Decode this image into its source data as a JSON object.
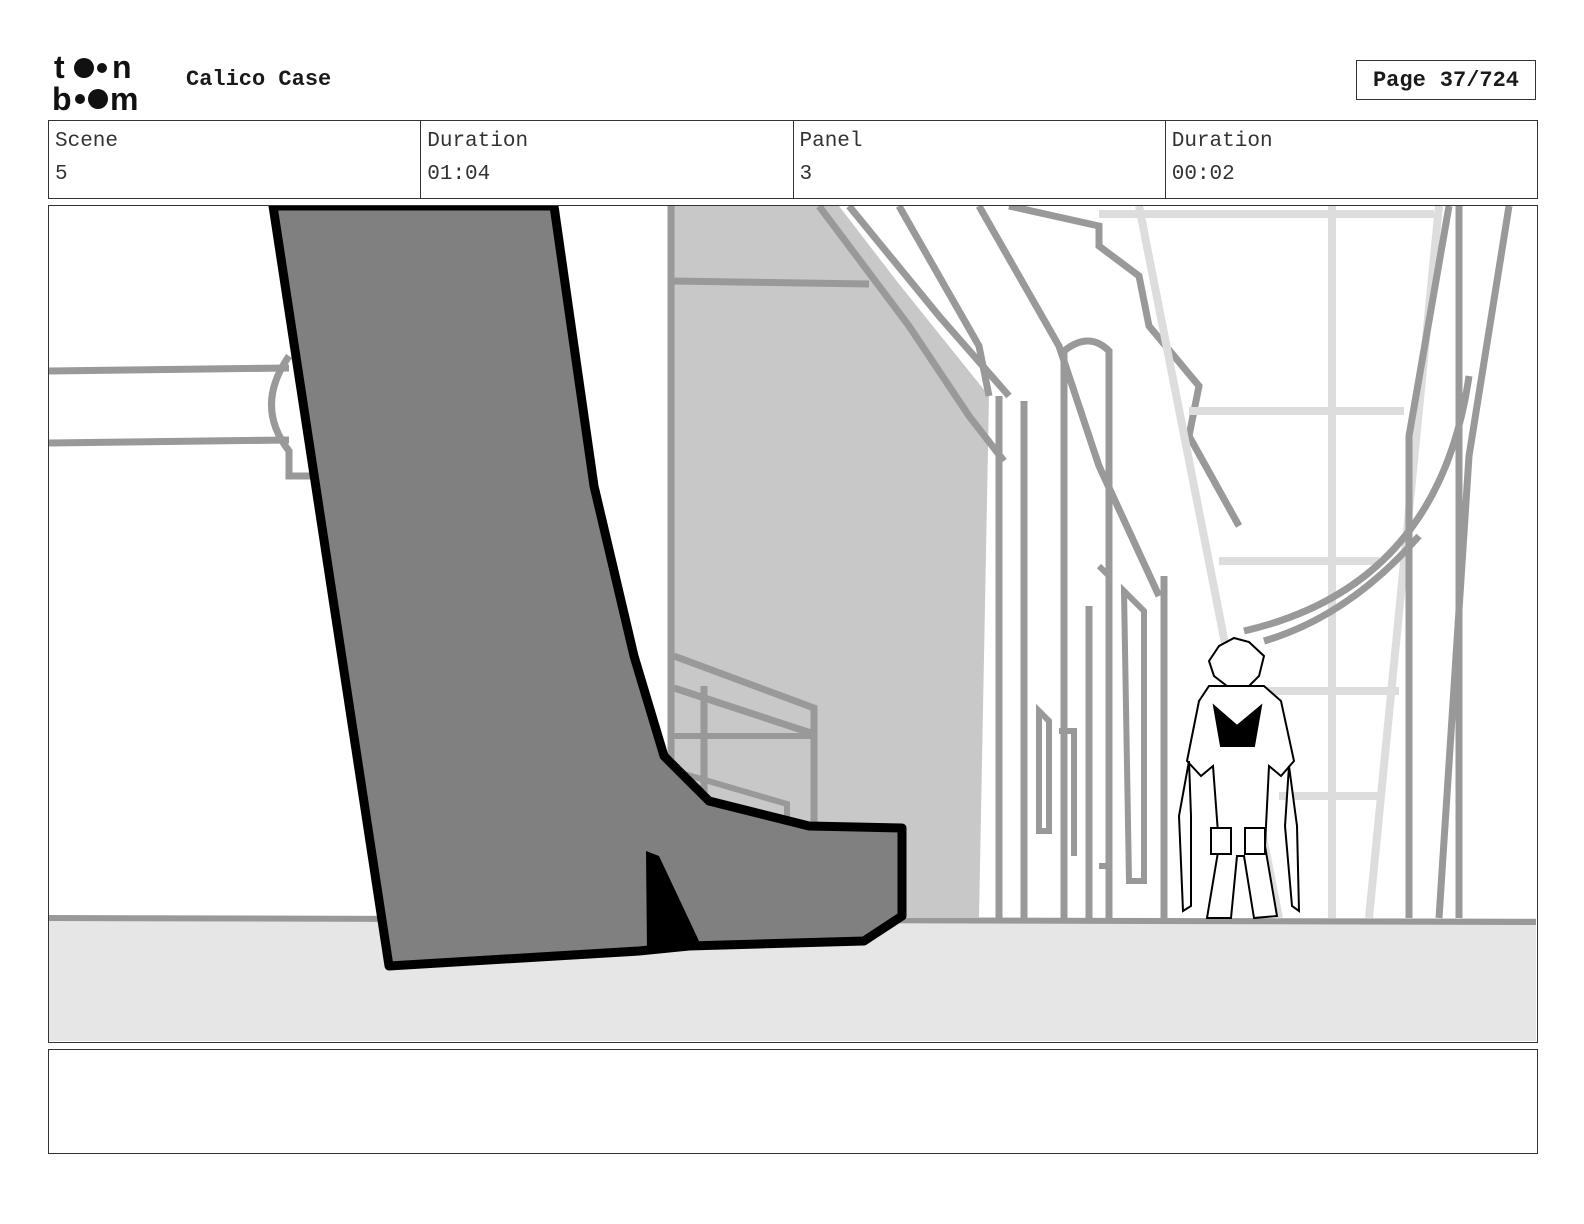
{
  "header": {
    "logo_text_top": "toon",
    "logo_text_bottom": "boom",
    "project_title": "Calico Case",
    "page_label": "Page",
    "page_value": "37/724"
  },
  "info": {
    "scene_label": "Scene",
    "scene_value": "5",
    "scene_duration_label": "Duration",
    "scene_duration_value": "01:04",
    "panel_label": "Panel",
    "panel_value": "3",
    "panel_duration_label": "Duration",
    "panel_duration_value": "00:02"
  },
  "panel": {
    "image_icon": "storyboard-drawing-boot-and-character"
  },
  "notes": {
    "text": ""
  },
  "colors": {
    "border": "#333333",
    "boot_fill": "#808080",
    "wall_fill": "#c8c8c8",
    "floor_fill": "#e6e6e6",
    "line_gray": "#999999",
    "light_line": "#dddddd"
  }
}
